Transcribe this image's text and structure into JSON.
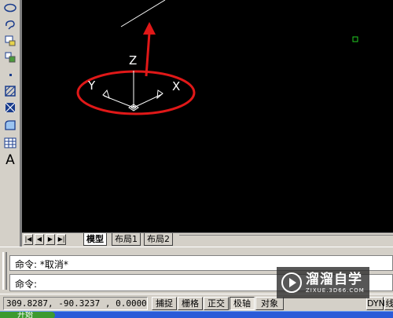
{
  "toolbar": {
    "icons": [
      "ellipse-icon",
      "revision-cloud-icon",
      "insert-block-icon",
      "make-block-icon",
      "point-icon",
      "hatch-icon",
      "gradient-icon",
      "region-icon",
      "table-icon",
      "multiline-text-icon"
    ],
    "text_tool_label": "A"
  },
  "canvas": {
    "background": "#000000",
    "ucs_labels": {
      "x": "X",
      "y": "Y",
      "z": "Z"
    },
    "annotation_color": "#e01818"
  },
  "layout_tabs": {
    "nav": [
      "|◀",
      "◀",
      "▶",
      "▶|"
    ],
    "tabs": [
      {
        "label": "模型",
        "active": true
      },
      {
        "label": "布局1",
        "active": false
      },
      {
        "label": "布局2",
        "active": false
      }
    ]
  },
  "command": {
    "history": "命令: *取消*",
    "prompt": "命令:"
  },
  "status": {
    "coordinates": "309.8287, -90.3237 , 0.0000",
    "toggles": [
      {
        "label": "捕捉",
        "on": false
      },
      {
        "label": "栅格",
        "on": false
      },
      {
        "label": "正交",
        "on": false
      },
      {
        "label": "极轴",
        "on": true
      },
      {
        "label": "对象",
        "on": false
      },
      {
        "label": "DYN",
        "on": false
      },
      {
        "label": "线",
        "on": false
      }
    ]
  },
  "taskbar": {
    "start_label": "开始"
  },
  "watermark": {
    "title": "溜溜自学",
    "subtitle": "ZIXUE.3D66.COM"
  }
}
